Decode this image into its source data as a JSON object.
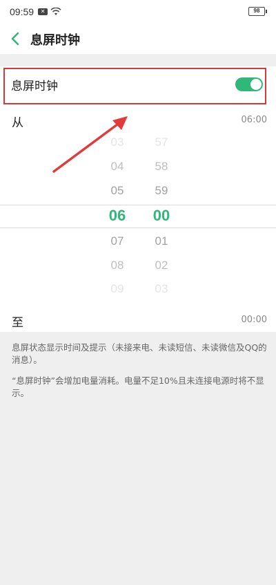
{
  "status_bar": {
    "time": "09:59",
    "battery": "98",
    "icons": [
      "sim-icon",
      "wifi-icon"
    ]
  },
  "header": {
    "title": "息屏时钟",
    "back_icon": "chevron-left-icon"
  },
  "toggle": {
    "label": "息屏时钟",
    "on": true,
    "accent_color": "#2fb877"
  },
  "from": {
    "label": "从",
    "value": "06:00"
  },
  "picker": {
    "hours": [
      "03",
      "04",
      "05",
      "06",
      "07",
      "08",
      "09"
    ],
    "minutes": [
      "57",
      "58",
      "59",
      "00",
      "01",
      "02",
      "03"
    ],
    "selected_hour": "06",
    "selected_minute": "00"
  },
  "to": {
    "label": "至",
    "value": "00:00"
  },
  "notes": [
    "息屏状态显示时间及提示（未接来电、未读短信、未读微信及QQ的消息）。",
    "“息屏时钟”会增加电量消耗。电量不足10%且未连接电源时将不显示。"
  ],
  "annotation": {
    "box_color": "#d9363a",
    "arrow_color": "#e23b3b"
  }
}
